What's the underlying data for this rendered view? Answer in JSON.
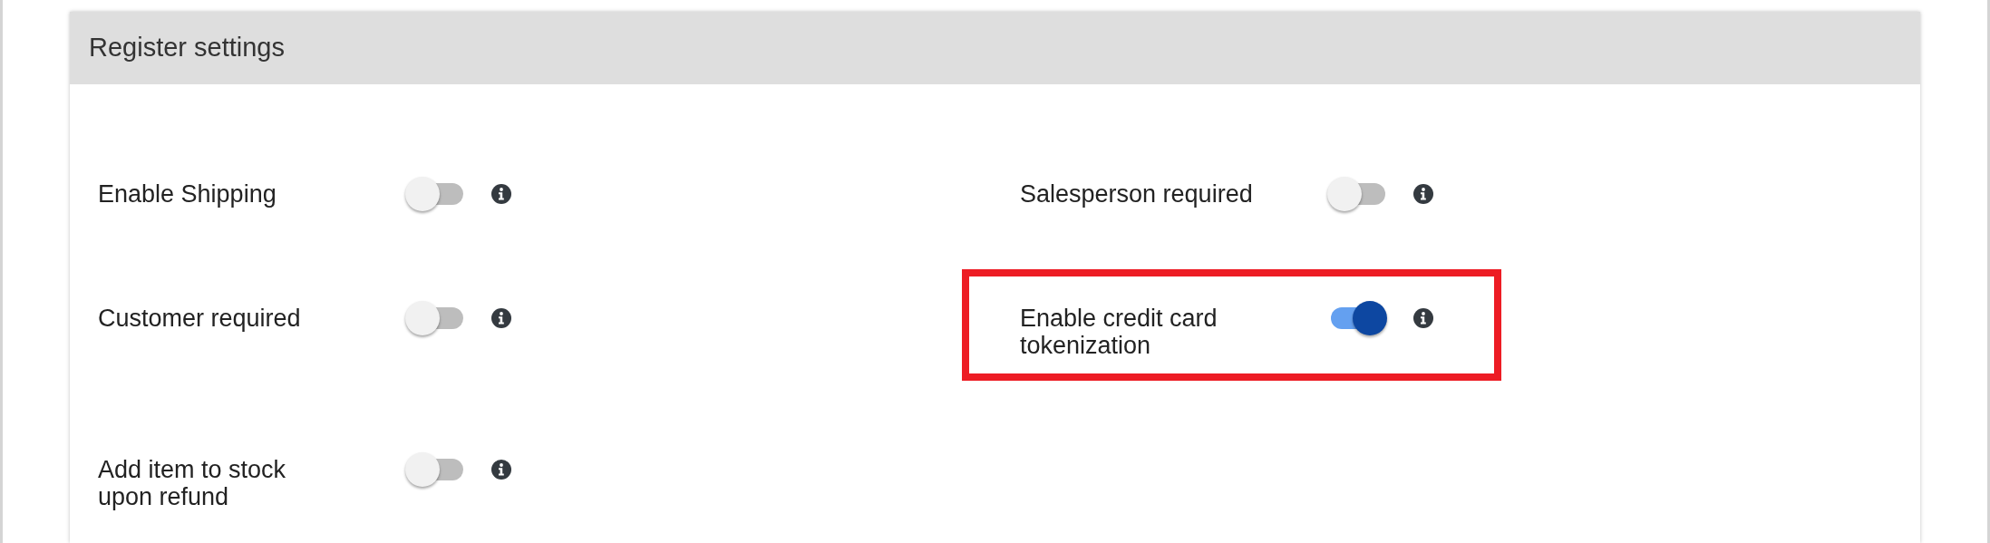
{
  "panel": {
    "title": "Register settings"
  },
  "settings": [
    {
      "label": "Enable Shipping",
      "on": false,
      "highlighted": false
    },
    {
      "label": "Salesperson required",
      "on": false,
      "highlighted": false
    },
    {
      "label": "Customer required",
      "on": false,
      "highlighted": false
    },
    {
      "label": "Enable credit card tokenization",
      "on": true,
      "highlighted": true
    },
    {
      "label": "Add item to stock upon refund",
      "on": false,
      "highlighted": false
    }
  ]
}
